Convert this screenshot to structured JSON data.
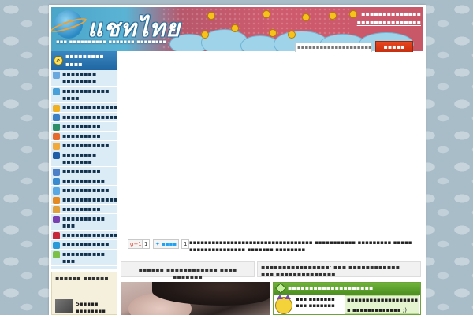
{
  "header": {
    "logo": "แชทไทย",
    "tagline": "▪▪▪ ▪▪▪▪▪▪▪▪▪▪ ▪▪▪▪▪▪▪ ▪▪▪▪▪▪▪▪▪▪▪ ▪▪▪▪▪▪▪▪ ▪▪▪▪▪",
    "top_link": "▪▪▪▪▪▪▪▪▪▪▪▪▪▪ ▪▪▪▪▪▪▪▪▪▪▪▪▪▪▪",
    "search_placeholder": "▪▪▪▪▪▪▪▪▪▪▪▪▪▪▪▪▪▪▪▪▪▪",
    "search_button": "▪▪▪▪▪"
  },
  "sidebar": {
    "title": "▪▪▪▪▪▪▪▪▪ ▪▪▪▪",
    "items": [
      {
        "label": "▪▪▪▪▪▪▪▪ ▪▪▪▪▪▪▪▪",
        "color": "#6aa8e0"
      },
      {
        "label": "▪▪▪▪▪▪▪▪▪▪▪ ▪▪▪▪",
        "color": "#4aa0d8"
      },
      {
        "label": "▪▪▪▪▪▪▪▪▪▪▪▪▪",
        "color": "#f0b020"
      },
      {
        "label": "▪▪▪▪▪▪▪▪▪▪▪▪▪",
        "color": "#3b7fc4"
      },
      {
        "label": "▪▪▪▪▪▪▪▪▪",
        "color": "#2d8f6a"
      },
      {
        "label": "▪▪▪▪▪▪▪▪▪",
        "color": "#e66a2c"
      },
      {
        "label": "▪▪▪▪▪▪▪▪▪▪▪",
        "color": "#f2a93b"
      },
      {
        "label": "▪▪▪▪▪▪▪▪ ▪▪▪▪▪▪▪",
        "color": "#1f5fa8"
      },
      {
        "label": "▪▪▪▪▪▪▪▪▪",
        "color": "#4d7fc8"
      },
      {
        "label": "▪▪▪▪▪▪▪▪▪▪",
        "color": "#3a8ad0"
      },
      {
        "label": "▪▪▪▪▪▪▪▪▪▪▪",
        "color": "#59a8e4"
      },
      {
        "label": "▪▪▪▪▪▪▪▪▪▪▪▪▪",
        "color": "#e58a22"
      },
      {
        "label": "▪▪▪▪▪▪▪▪▪",
        "color": "#e2a03a"
      },
      {
        "label": "▪▪▪▪▪▪▪▪▪▪ ▪▪▪",
        "color": "#7a3fb0"
      },
      {
        "label": "▪▪▪▪▪▪▪▪▪▪▪▪▪",
        "color": "#c8283a"
      },
      {
        "label": "▪▪▪▪▪▪▪▪▪▪▪",
        "color": "#2a9ad8"
      },
      {
        "label": "▪▪▪▪▪▪▪▪▪▪ ▪▪▪",
        "color": "#7cc04a"
      }
    ]
  },
  "sidebar_box2": {
    "title": "▪▪▪▪▪▪ ▪▪▪▪▪▪",
    "item": "5▪▪▪▪▪ ▪▪▪▪▪▪▪▪ ▪▪▪▪▪▪"
  },
  "share": {
    "gplus": "g+1",
    "gplus_count": "1",
    "tweet": "▪▪▪▪",
    "like_count": "1",
    "text": "▪▪▪▪▪▪▪▪▪▪▪▪▪▪▪▪▪▪▪▪▪▪▪▪▪▪▪▪▪▪▪▪▪ ▪▪▪▪▪▪▪▪▪▪▪ ▪▪▪▪▪▪▪▪▪ ▪▪▪▪▪ ▪▪▪▪▪▪▪▪▪▪▪▪▪▪▪ ▪▪▪▪▪▪▪ ▪▪▪▪▪▪▪▪"
  },
  "breadcrumb": {
    "left": "▪▪▪▪▪▪ ▪▪▪▪▪▪▪▪▪▪▪▪ ▪▪▪▪ ▪▪▪▪▪▪▪",
    "right_prefix": "▪▪▪▪▪▪▪▪▪▪▪▪▪▪▪▪: ",
    "right_bold": "▪▪▪ ▪▪▪▪▪▪▪▪▪▪▪▪",
    "right_suffix": " . ▪▪▪ ▪▪▪▪▪▪▪▪▪▪▪▪▪▪"
  },
  "green_panel": {
    "title": "▪▪▪▪▪▪▪▪▪▪▪▪▪▪▪▪▪▪▪▪",
    "user": "▪▪▪ ▪▪▪▪▪▪▪ ▪▪▪ ▪▪▪▪▪▪▪",
    "msg1": "▪▪▪▪▪▪▪▪▪▪▪▪▪▪▪▪▪▪▪!",
    "msg2": "▪ ▪▪▪▪▪▪▪▪▪▪▪▪▪ ;)"
  }
}
